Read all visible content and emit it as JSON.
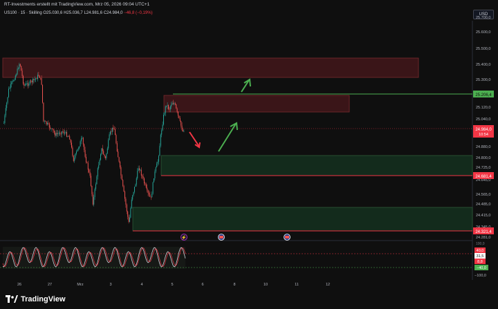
{
  "attribution": "RT-Investments erstellt mit TradingView.com, Mrz 05, 2026 09:04 UTC+1",
  "symbol": {
    "name": "US100 · 15 · Skilling",
    "open": "O25.030,6",
    "high": "H25.036,7",
    "low": "L24.981,6",
    "close": "C24.984,0",
    "change": "−46,8 (−0,19%)"
  },
  "currency": "USD",
  "price_axis": [
    "25.700,0",
    "25.600,0",
    "25.500,0",
    "25.400,0",
    "25.300,0",
    "25.200,0",
    "25.120,0",
    "25.040,0",
    "24.960,0",
    "24.880,0",
    "24.800,0",
    "24.725,0",
    "24.645,0",
    "24.565,0",
    "24.485,0",
    "24.415,0",
    "24.345,0",
    "24.281,0"
  ],
  "price_tags": {
    "green": "25.206,4",
    "current": "24.984,0",
    "countdown": "10:54",
    "red_mid": "24.681,4",
    "red_low": "24.321,4"
  },
  "osc_axis": {
    "title": "100,0",
    "upper": "40,0",
    "value": "31,5",
    "mid": "8,8",
    "lower": "−40,0",
    "bottom": "−100,0"
  },
  "time_axis": [
    "26",
    "27",
    "Mrz",
    "3",
    "4",
    "5",
    "6",
    "8",
    "10",
    "11",
    "12"
  ],
  "event_icons": [
    "lightning-icon",
    "flag-icon",
    "flag-icon"
  ],
  "colors": {
    "up": "#26a69a",
    "down": "#ef5350",
    "resistance_zone": "#3a1518",
    "support_zone": "#132b1c",
    "green_line": "#4caf50",
    "red_line": "#f23645"
  },
  "brand": "TradingView"
}
